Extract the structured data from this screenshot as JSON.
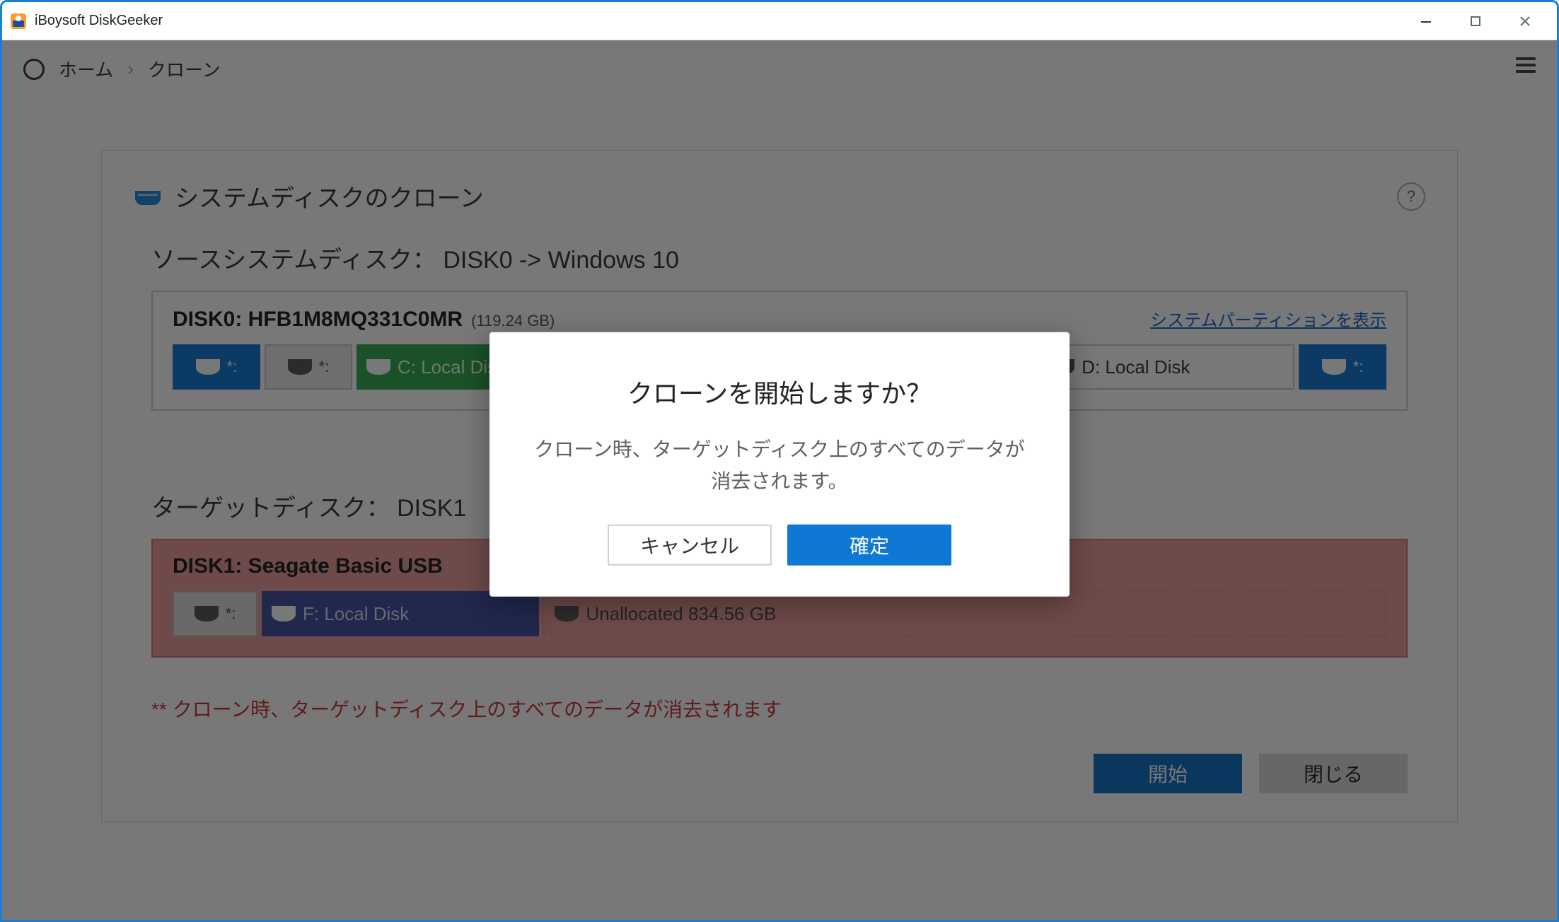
{
  "titlebar": {
    "app_title": "iBoysoft DiskGeeker"
  },
  "breadcrumb": {
    "home": "ホーム",
    "sep": "›",
    "current": "クローン"
  },
  "panel": {
    "title": "システムディスクのクローン",
    "help": "?",
    "source_label": "ソースシステムディスク：  DISK0 -> Windows 10",
    "source_disk": {
      "name": "DISK0: HFB1M8MQ331C0MR",
      "size": "(119.24 GB)",
      "show_partitions": "システムパーティションを表示",
      "parts": {
        "p1": "*:",
        "p2": "*:",
        "p3": "C: Local Disk",
        "p4": "*:",
        "p5": "D: Local Disk",
        "p6": "*:"
      }
    },
    "target_label": "ターゲットディスク：  DISK1",
    "target_disk": {
      "name": "DISK1: Seagate Basic USB",
      "parts": {
        "p1": "*:",
        "p2": "F: Local Disk",
        "p3": "Unallocated 834.56 GB"
      }
    },
    "warning": "** クローン時、ターゲットディスク上のすべてのデータが消去されます",
    "start_btn": "開始",
    "close_btn": "閉じる"
  },
  "modal": {
    "title": "クローンを開始しますか？",
    "message": "クローン時、ターゲットディスク上のすべてのデータが消去されます。",
    "cancel": "キャンセル",
    "confirm": "確定"
  }
}
